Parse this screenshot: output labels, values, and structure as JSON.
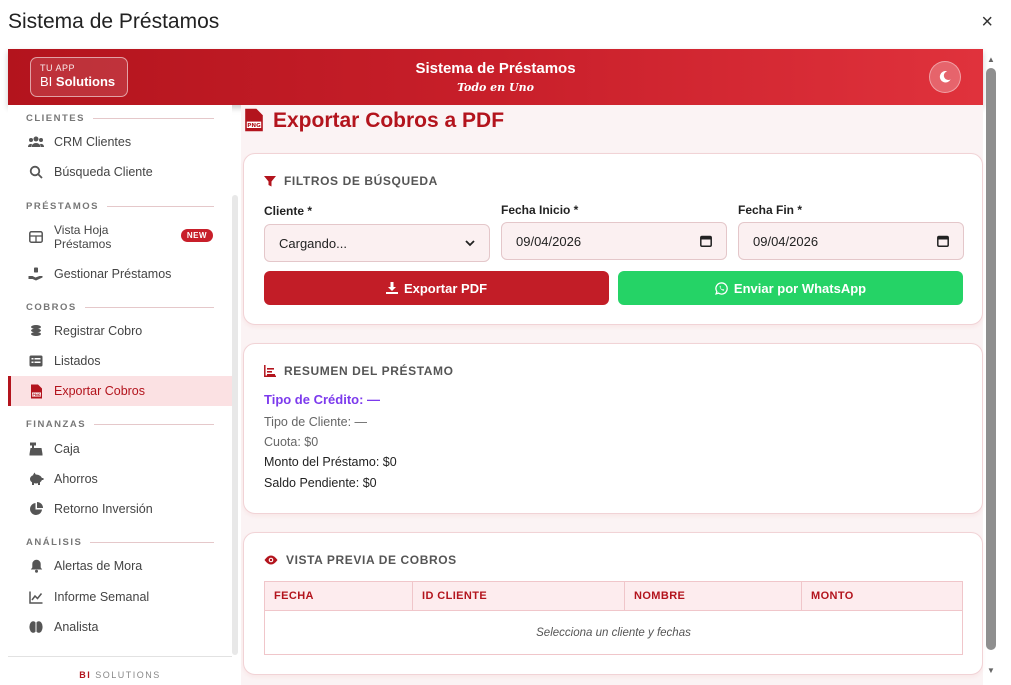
{
  "window": {
    "title": "Sistema de Préstamos",
    "close_icon": "×"
  },
  "header": {
    "brand_small": "TU APP",
    "brand_prefix": "BI",
    "brand_strong": "Solutions",
    "title": "Sistema de Préstamos",
    "subtitle": "Todo en Uno",
    "theme_icon": "moon-icon"
  },
  "sidebar": {
    "sections": {
      "clientes": "CLIENTES",
      "prestamos": "PRÉSTAMOS",
      "cobros": "COBROS",
      "finanzas": "FINANZAS",
      "analisis": "ANÁLISIS"
    },
    "items": {
      "crm": "CRM Clientes",
      "busqueda": "Búsqueda Cliente",
      "vista_hoja_l1": "Vista Hoja",
      "vista_hoja_l2": "Préstamos",
      "new_badge": "NEW",
      "gestionar": "Gestionar Préstamos",
      "registrar": "Registrar Cobro",
      "listados": "Listados",
      "exportar": "Exportar Cobros",
      "caja": "Caja",
      "ahorros": "Ahorros",
      "retorno": "Retorno Inversión",
      "alertas": "Alertas de Mora",
      "informe": "Informe Semanal",
      "analista": "Analista"
    },
    "footer_strong": "BI",
    "footer_rest": " SOLUTIONS"
  },
  "page": {
    "title": "Exportar Cobros a PDF"
  },
  "filters": {
    "heading": "FILTROS DE BÚSQUEDA",
    "cliente_label": "Cliente *",
    "cliente_value": "Cargando...",
    "inicio_label": "Fecha Inicio *",
    "inicio_value": "09/04/2026",
    "fin_label": "Fecha Fin *",
    "fin_value": "09/04/2026",
    "export_btn": "Exportar PDF",
    "whatsapp_btn": "Enviar por WhatsApp"
  },
  "summary": {
    "heading": "RESUMEN DEL PRÉSTAMO",
    "tipo_credito": "Tipo de Crédito: —",
    "tipo_cliente": "Tipo de Cliente: —",
    "cuota": "Cuota: $0",
    "monto": "Monto del Préstamo: $0",
    "saldo": "Saldo Pendiente: $0"
  },
  "preview": {
    "heading": "VISTA PREVIA DE COBROS",
    "columns": [
      "FECHA",
      "ID CLIENTE",
      "NOMBRE",
      "MONTO"
    ],
    "empty": "Selecciona un cliente y fechas"
  },
  "colors": {
    "primary": "#c21d27",
    "whatsapp": "#25d366",
    "accent_purple": "#7c3aed"
  }
}
